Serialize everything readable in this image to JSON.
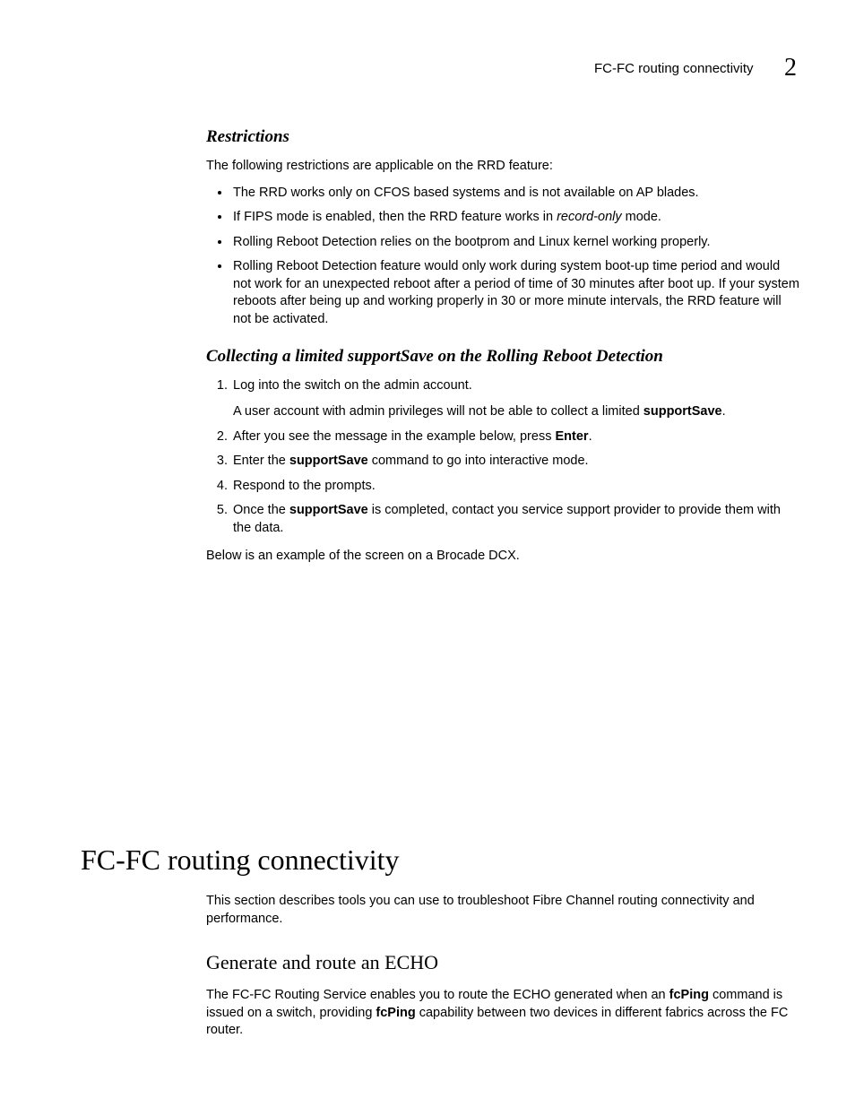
{
  "header": {
    "running_title": "FC-FC routing connectivity",
    "chapter_number": "2"
  },
  "restrictions": {
    "heading": "Restrictions",
    "intro": "The following restrictions are applicable on the RRD feature:",
    "bullets": [
      "The RRD works only on CFOS based systems and is not available on AP blades.",
      {
        "pre": "If FIPS mode is enabled, then the RRD feature works in ",
        "em": "record-only",
        "post": " mode."
      },
      "Rolling Reboot Detection relies on the bootprom and Linux kernel working properly.",
      "Rolling Reboot Detection feature would only work during system boot-up time period and would not work for an unexpected reboot after a period of time of 30 minutes after boot up. If your system reboots after being up and working properly in 30 or more minute intervals, the RRD feature will not be activated."
    ]
  },
  "collecting": {
    "heading": "Collecting a limited supportSave on the Rolling Reboot Detection",
    "steps": {
      "s1a": "Log into the switch on the admin account.",
      "s1b_pre": "A user account with admin privileges will not be able to collect a limited ",
      "s1b_bold": "supportSave",
      "s1b_post": ".",
      "s2_pre": "After you see the message in the example below, press ",
      "s2_bold": "Enter",
      "s2_post": ".",
      "s3_pre": "Enter the ",
      "s3_bold": "supportSave",
      "s3_post": " command to go into interactive mode.",
      "s4": "Respond to the prompts.",
      "s5_pre": "Once the ",
      "s5_bold": "supportSave",
      "s5_post": " is completed, contact you service support provider to provide them with the data."
    },
    "outro": "Below is an example of the screen on a Brocade DCX."
  },
  "fcfc": {
    "heading": "FC-FC routing connectivity",
    "intro": "This section describes tools you can use to troubleshoot Fibre Channel routing connectivity and performance.",
    "sub_heading": "Generate and route an ECHO",
    "para_pre": "The FC-FC Routing Service enables you to route the ECHO generated when an ",
    "para_b1": "fcPing",
    "para_mid": " command is issued on a switch, providing ",
    "para_b2": "fcPing",
    "para_post": " capability between two devices in different fabrics across the FC router."
  }
}
